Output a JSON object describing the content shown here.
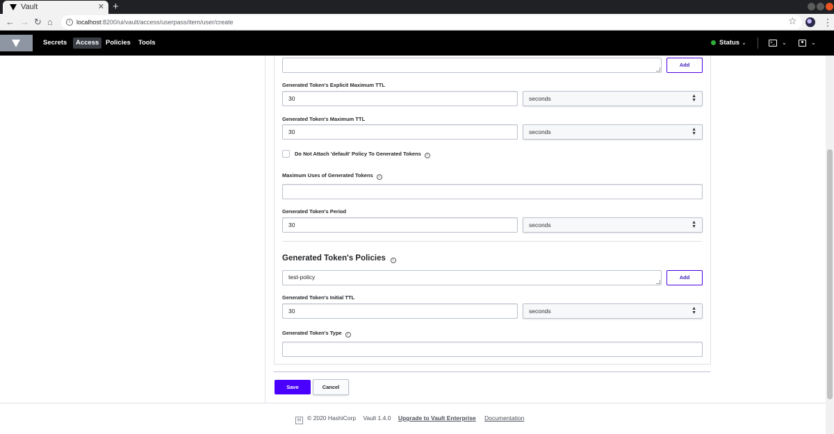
{
  "browser": {
    "tab_title": "Vault",
    "tab_close": "✕",
    "new_tab": "+",
    "url_host": "localhost",
    "url_path": ":8200/ui/vault/access/userpass/item/user/create"
  },
  "nav": {
    "items": [
      "Secrets",
      "Access",
      "Policies",
      "Tools"
    ],
    "active": "Access",
    "status_label": "Status",
    "status_color": "#2eb039"
  },
  "form": {
    "top_add_label": "Add",
    "explicit_max_ttl": {
      "label": "Generated Token's Explicit Maximum TTL",
      "value": "30",
      "unit": "seconds"
    },
    "max_ttl": {
      "label": "Generated Token's Maximum TTL",
      "value": "30",
      "unit": "seconds"
    },
    "no_default_policy": {
      "label": "Do Not Attach 'default' Policy To Generated Tokens",
      "checked": false
    },
    "max_uses": {
      "label": "Maximum Uses of Generated Tokens",
      "value": ""
    },
    "period": {
      "label": "Generated Token's Period",
      "value": "30",
      "unit": "seconds"
    },
    "policies_section": {
      "title": "Generated Token's Policies",
      "value": "test-policy",
      "add_label": "Add"
    },
    "initial_ttl": {
      "label": "Generated Token's Initial TTL",
      "value": "30",
      "unit": "seconds"
    },
    "token_type": {
      "label": "Generated Token's Type",
      "value": ""
    },
    "save_label": "Save",
    "cancel_label": "Cancel"
  },
  "footer": {
    "copyright": "© 2020 HashiCorp",
    "version": "Vault 1.4.0",
    "upgrade_link": "Upgrade to Vault Enterprise",
    "docs_link": "Documentation"
  },
  "colors": {
    "primary": "#4a00ff",
    "nav_bg": "#000000"
  }
}
